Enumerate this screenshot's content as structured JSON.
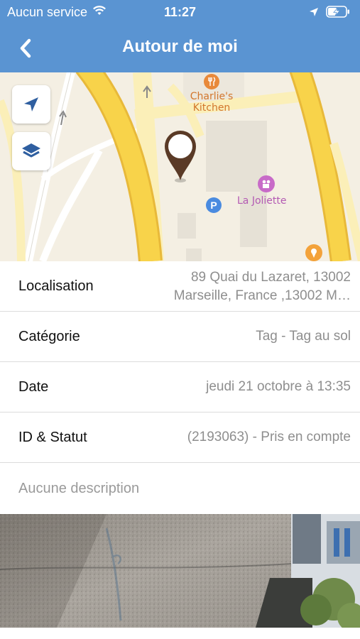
{
  "status_bar": {
    "carrier": "Aucun service",
    "time": "11:27"
  },
  "nav": {
    "title": "Autour de moi",
    "back_icon": "chevron-left-icon"
  },
  "map": {
    "controls": [
      "location-arrow-icon",
      "layers-icon"
    ],
    "pois": [
      {
        "name": "Charlie's\nKitchen",
        "icon": "restaurant-icon",
        "color": "#e8893a"
      },
      {
        "name": "La Joliette",
        "icon": "cinema-icon",
        "color": "#c86bc8"
      }
    ],
    "marker_icon": "map-pin-icon"
  },
  "details": [
    {
      "label": "Localisation",
      "value_line1": "89 Quai du Lazaret, 13002",
      "value_line2": "Marseille, France ,13002 M…"
    },
    {
      "label": "Catégorie",
      "value": "Tag - Tag au sol"
    },
    {
      "label": "Date",
      "value": "jeudi 21 octobre à 13:35"
    },
    {
      "label": "ID & Statut",
      "value": "(2193063) - Pris en compte"
    }
  ],
  "description_placeholder": "Aucune description",
  "colors": {
    "accent": "#5a94d2",
    "road_yellow": "#f8d34a",
    "road_border": "#e8b93a",
    "map_bg": "#f4efe3",
    "marker": "#5a3a26"
  }
}
